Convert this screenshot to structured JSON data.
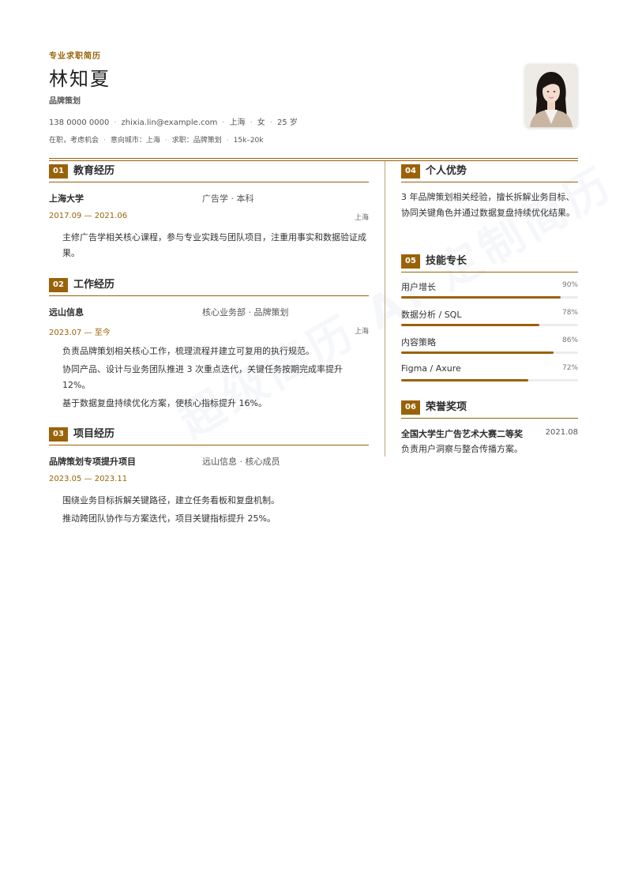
{
  "header": {
    "kicker": "专业求职简历",
    "name": "林知夏",
    "role": "品牌策划",
    "contact": [
      "138 0000 0000",
      "zhixia.lin@example.com",
      "上海",
      "女",
      "25 岁"
    ],
    "status": [
      "在职，考虑机会",
      "意向城市：上海",
      "求职：品牌策划",
      "15k–20k"
    ]
  },
  "watermark": "超级简历 AI 定制简历",
  "theme": {
    "accent": "#9a6208",
    "text": "#2b2b2b",
    "track": "#ecebf0"
  },
  "sections": {
    "education": {
      "num": "01",
      "title": "教育经历"
    },
    "work": {
      "num": "02",
      "title": "工作经历"
    },
    "project": {
      "num": "03",
      "title": "项目经历"
    },
    "advantage": {
      "num": "04",
      "title": "个人优势"
    },
    "skills": {
      "num": "05",
      "title": "技能专长"
    },
    "awards": {
      "num": "06",
      "title": "荣誉奖项"
    }
  },
  "education": {
    "org": "上海大学",
    "meta": "广告学 · 本科",
    "date": "2017.09 — 2021.06",
    "place": "上海",
    "bullets": [
      "主修广告学相关核心课程，参与专业实践与团队项目，注重用事实和数据验证成果。"
    ]
  },
  "work": {
    "org": "远山信息",
    "meta": "核心业务部 · 品牌策划",
    "date": "2023.07 — 至今",
    "place": "上海",
    "bullets": [
      "负责品牌策划相关核心工作，梳理流程并建立可复用的执行规范。",
      "协同产品、设计与业务团队推进 3 次重点迭代，关键任务按期完成率提升 12%。",
      "基于数据复盘持续优化方案，使核心指标提升 16%。"
    ]
  },
  "project": {
    "org": "品牌策划专项提升项目",
    "meta": "远山信息 · 核心成员",
    "date": "2023.05 — 2023.11",
    "bullets": [
      "围绕业务目标拆解关键路径，建立任务看板和复盘机制。",
      "推动跨团队协作与方案迭代，项目关键指标提升 25%。"
    ]
  },
  "advantage": {
    "text": "3 年品牌策划相关经验，擅长拆解业务目标、协同关键角色并通过数据复盘持续优化结果。"
  },
  "skills": [
    {
      "name": "用户增长",
      "label": "90%",
      "value": 0.9
    },
    {
      "name": "数据分析 / SQL",
      "label": "78%",
      "value": 0.78
    },
    {
      "name": "内容策略",
      "label": "86%",
      "value": 0.86
    },
    {
      "name": "Figma / Axure",
      "label": "72%",
      "value": 0.72
    }
  ],
  "awards": [
    {
      "name": "全国大学生广告艺术大赛二等奖",
      "date": "2021.08",
      "desc": "负责用户洞察与整合传播方案。"
    }
  ]
}
